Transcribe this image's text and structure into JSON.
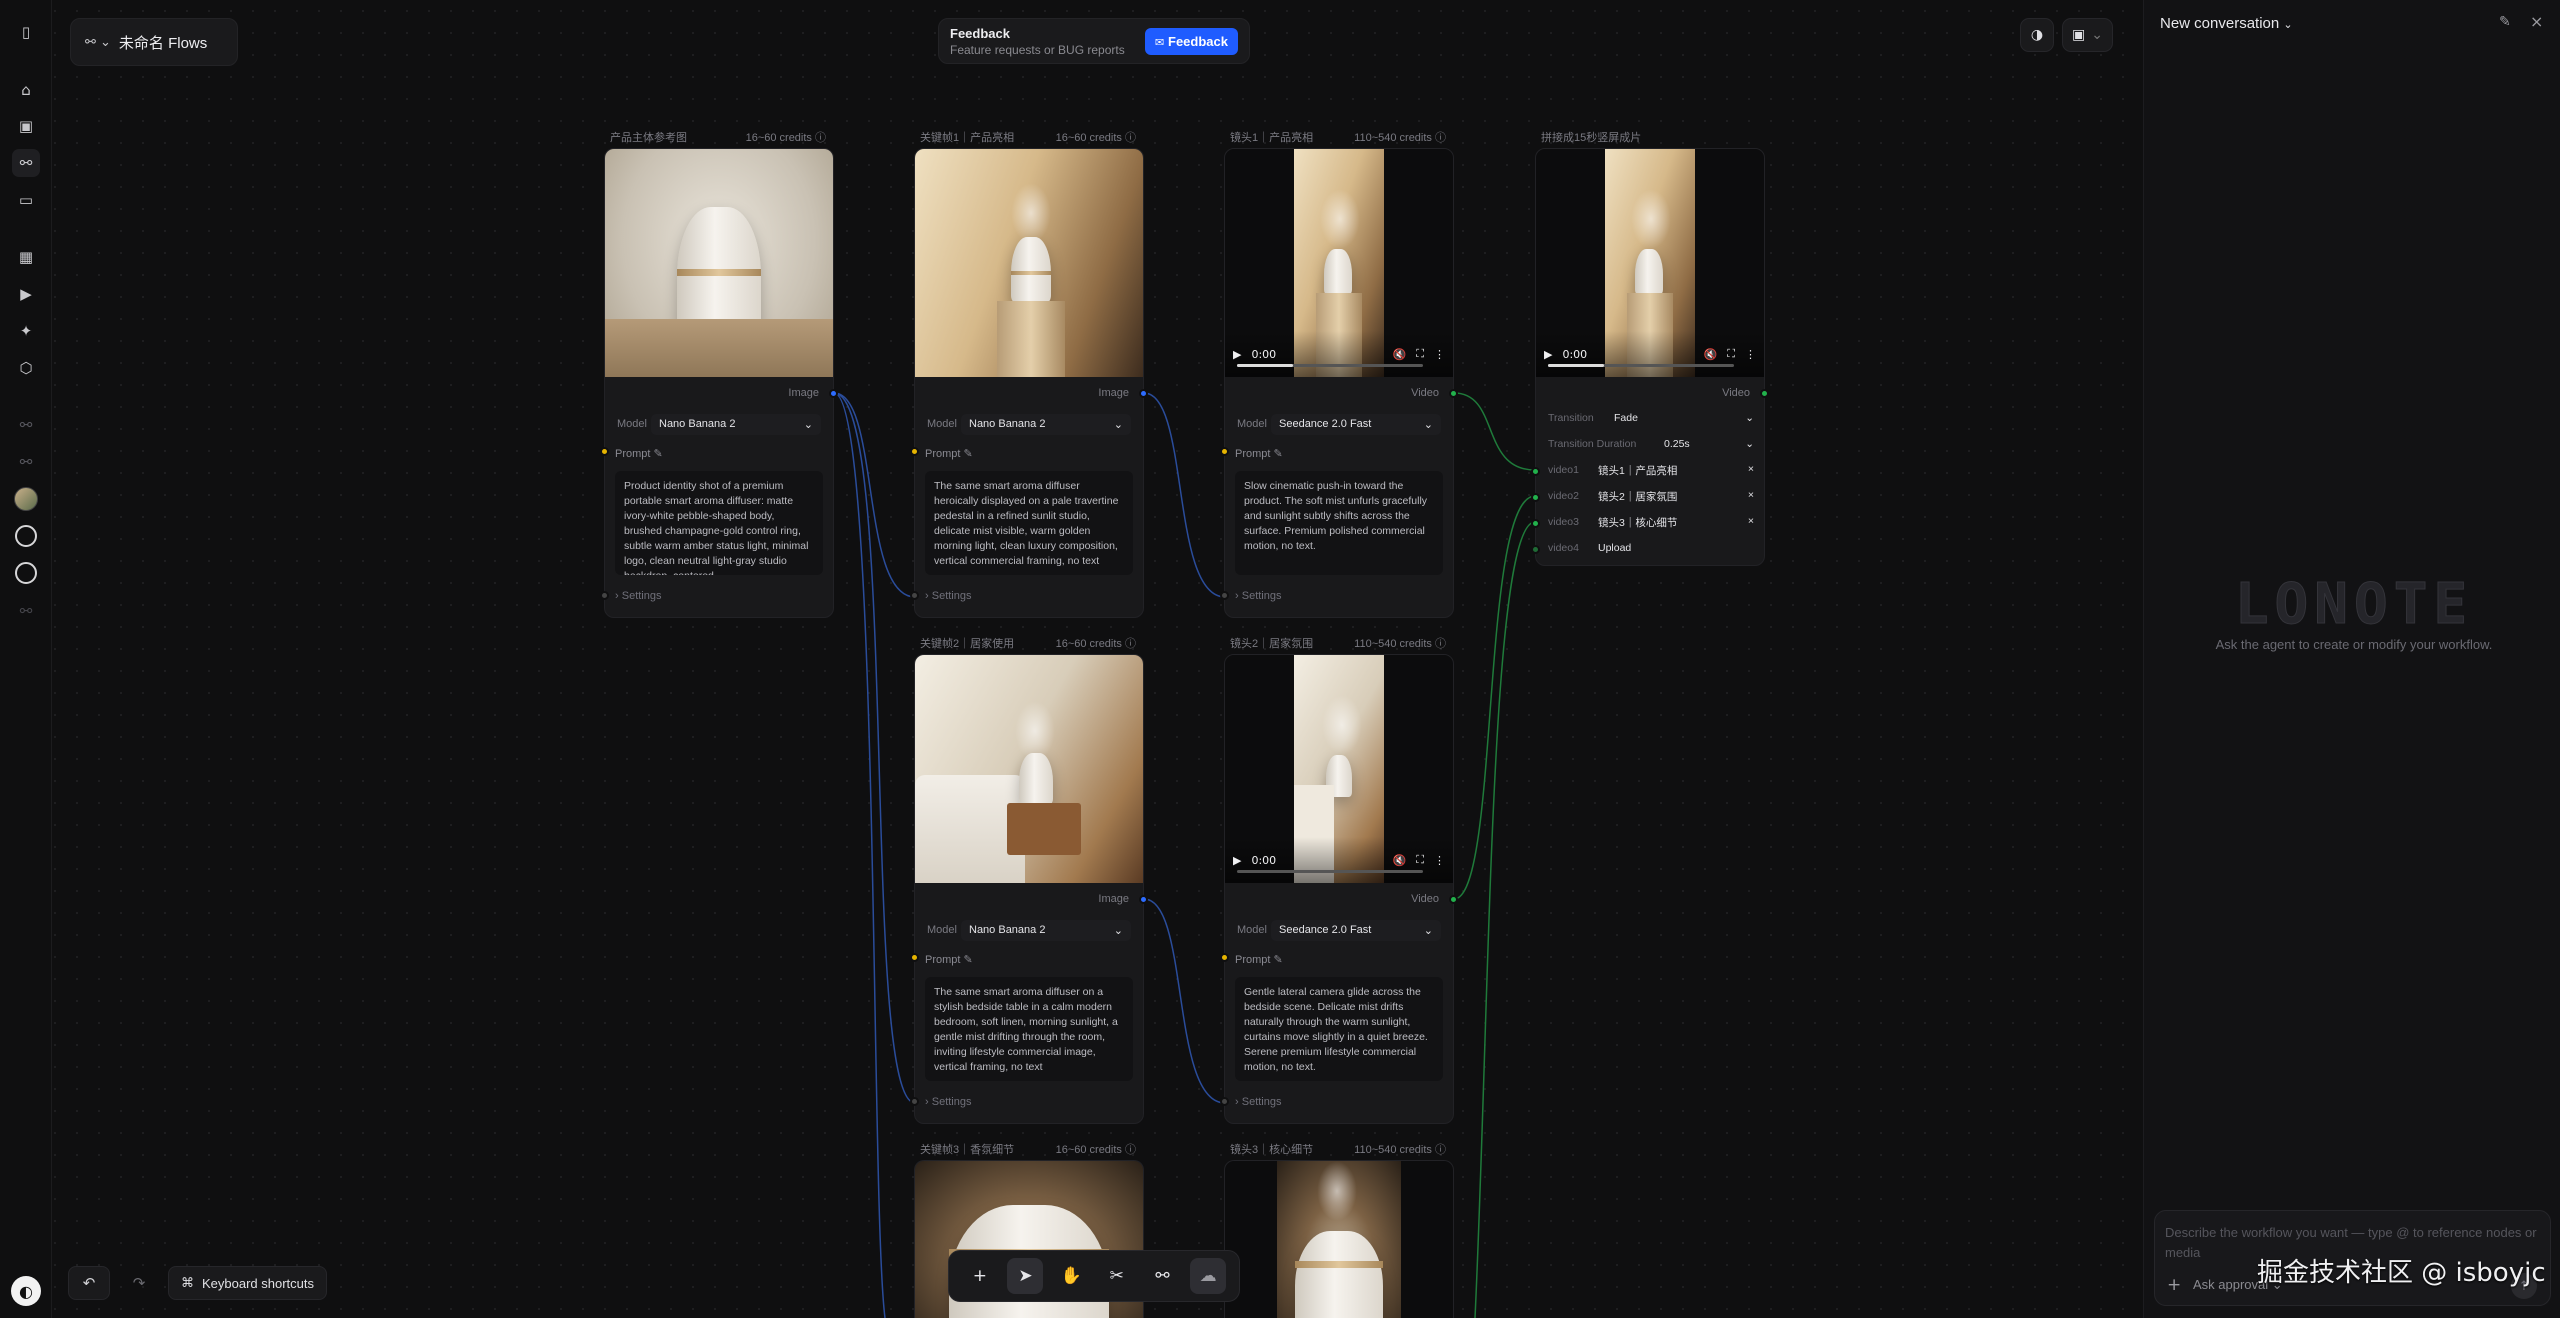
{
  "app": {
    "flow_name": "未命名 Flows"
  },
  "feedback": {
    "title": "Feedback",
    "subtitle": "Feature requests or BUG reports",
    "button": "Feedback"
  },
  "chat": {
    "title": "New conversation",
    "logo": "LONOTE",
    "hint": "Ask the agent to create or modify your workflow.",
    "placeholder": "Describe the workflow you want — type @ to reference nodes or media",
    "approval": "Ask approval"
  },
  "watermark": "掘金技术社区 @ isboyjc",
  "bottom": {
    "shortcuts": "Keyboard shortcuts"
  },
  "nodes": [
    {
      "title": "产品主体参考图",
      "credits": "16~60 credits",
      "port": "Image",
      "model_label": "Model",
      "model": "Nano Banana 2",
      "prompt_label": "Prompt",
      "prompt": "Product identity shot of a premium portable smart aroma diffuser: matte ivory-white pebble-shaped body, brushed champagne-gold control ring, subtle warm amber status light, minimal logo, clean neutral light-gray studio backdrop, centered",
      "settings": "Settings"
    },
    {
      "title": "关键帧1｜产品亮相",
      "credits": "16~60 credits",
      "port": "Image",
      "model_label": "Model",
      "model": "Nano Banana 2",
      "prompt_label": "Prompt",
      "prompt": "The same smart aroma diffuser heroically displayed on a pale travertine pedestal in a refined sunlit studio, delicate mist visible, warm golden morning light, clean luxury composition, vertical commercial framing, no text",
      "settings": "Settings"
    },
    {
      "title": "镜头1｜产品亮相",
      "credits": "110~540 credits",
      "port": "Video",
      "time": "0:00",
      "model_label": "Model",
      "model": "Seedance 2.0 Fast",
      "prompt_label": "Prompt",
      "prompt": "Slow cinematic push-in toward the product. The soft mist unfurls gracefully and sunlight subtly shifts across the surface. Premium polished commercial motion, no text.",
      "settings": "Settings"
    },
    {
      "title": "拼接成15秒竖屏成片",
      "port": "Video",
      "time": "0:00",
      "transition_label": "Transition",
      "transition": "Fade",
      "duration_label": "Transition Duration",
      "duration": "0.25s",
      "inputs": [
        {
          "key": "video1",
          "value": "镜头1｜产品亮相"
        },
        {
          "key": "video2",
          "value": "镜头2｜居家氛围"
        },
        {
          "key": "video3",
          "value": "镜头3｜核心细节"
        },
        {
          "key": "video4",
          "value": "Upload"
        }
      ]
    },
    {
      "title": "关键帧2｜居家使用",
      "credits": "16~60 credits",
      "port": "Image",
      "model_label": "Model",
      "model": "Nano Banana 2",
      "prompt_label": "Prompt",
      "prompt": "The same smart aroma diffuser on a stylish bedside table in a calm modern bedroom, soft linen, morning sunlight, a gentle mist drifting through the room, inviting lifestyle commercial image, vertical framing, no text",
      "settings": "Settings"
    },
    {
      "title": "镜头2｜居家氛围",
      "credits": "110~540 credits",
      "port": "Video",
      "time": "0:00",
      "model_label": "Model",
      "model": "Seedance 2.0 Fast",
      "prompt_label": "Prompt",
      "prompt": "Gentle lateral camera glide across the bedside scene. Delicate mist drifts naturally through the warm sunlight, curtains move slightly in a quiet breeze. Serene premium lifestyle commercial motion, no text.",
      "settings": "Settings"
    },
    {
      "title": "关键帧3｜香氛细节",
      "credits": "16~60 credits"
    },
    {
      "title": "镜头3｜核心细节",
      "credits": "110~540 credits"
    }
  ]
}
